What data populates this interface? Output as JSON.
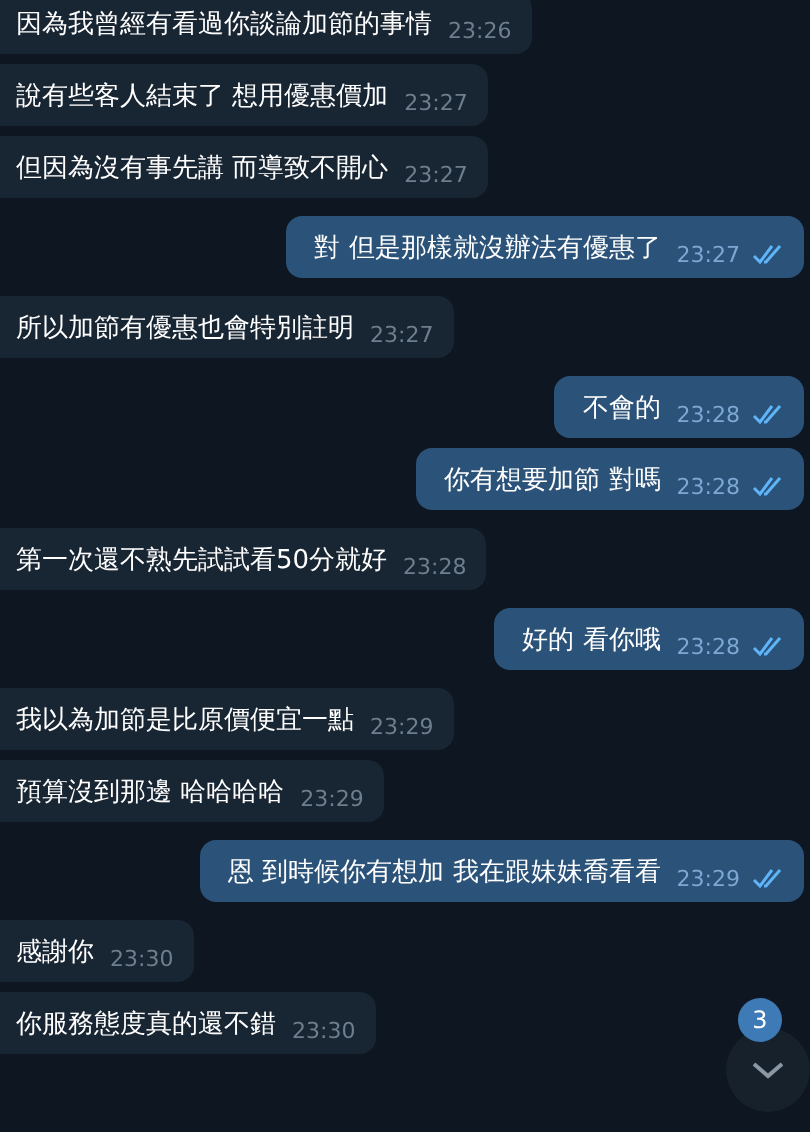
{
  "messages": [
    {
      "text": "因為我曾經有看過你談論加節的事情",
      "time": "23:26",
      "outgoing": false,
      "read": false
    },
    {
      "text": "說有些客人結束了 想用優惠價加",
      "time": "23:27",
      "outgoing": false,
      "read": false
    },
    {
      "text": "但因為沒有事先講 而導致不開心",
      "time": "23:27",
      "outgoing": false,
      "read": false
    },
    {
      "text": "對 但是那樣就沒辦法有優惠了",
      "time": "23:27",
      "outgoing": true,
      "read": true
    },
    {
      "text": "所以加節有優惠也會特別註明",
      "time": "23:27",
      "outgoing": false,
      "read": false
    },
    {
      "text": "不會的",
      "time": "23:28",
      "outgoing": true,
      "read": true
    },
    {
      "text": "你有想要加節  對嗎",
      "time": "23:28",
      "outgoing": true,
      "read": true
    },
    {
      "text": "第一次還不熟先試試看50分就好",
      "time": "23:28",
      "outgoing": false,
      "read": false
    },
    {
      "text": "好的 看你哦",
      "time": "23:28",
      "outgoing": true,
      "read": true
    },
    {
      "text": "我以為加節是比原價便宜一點",
      "time": "23:29",
      "outgoing": false,
      "read": false
    },
    {
      "text": "預算沒到那邊 哈哈哈哈",
      "time": "23:29",
      "outgoing": false,
      "read": false
    },
    {
      "text": "恩 到時候你有想加 我在跟妹妹喬看看",
      "time": "23:29",
      "outgoing": true,
      "read": true
    },
    {
      "text": "感謝你",
      "time": "23:30",
      "outgoing": false,
      "read": false
    },
    {
      "text": "你服務態度真的還不錯",
      "time": "23:30",
      "outgoing": false,
      "read": false
    }
  ],
  "scroll_button": {
    "badge": "3"
  }
}
